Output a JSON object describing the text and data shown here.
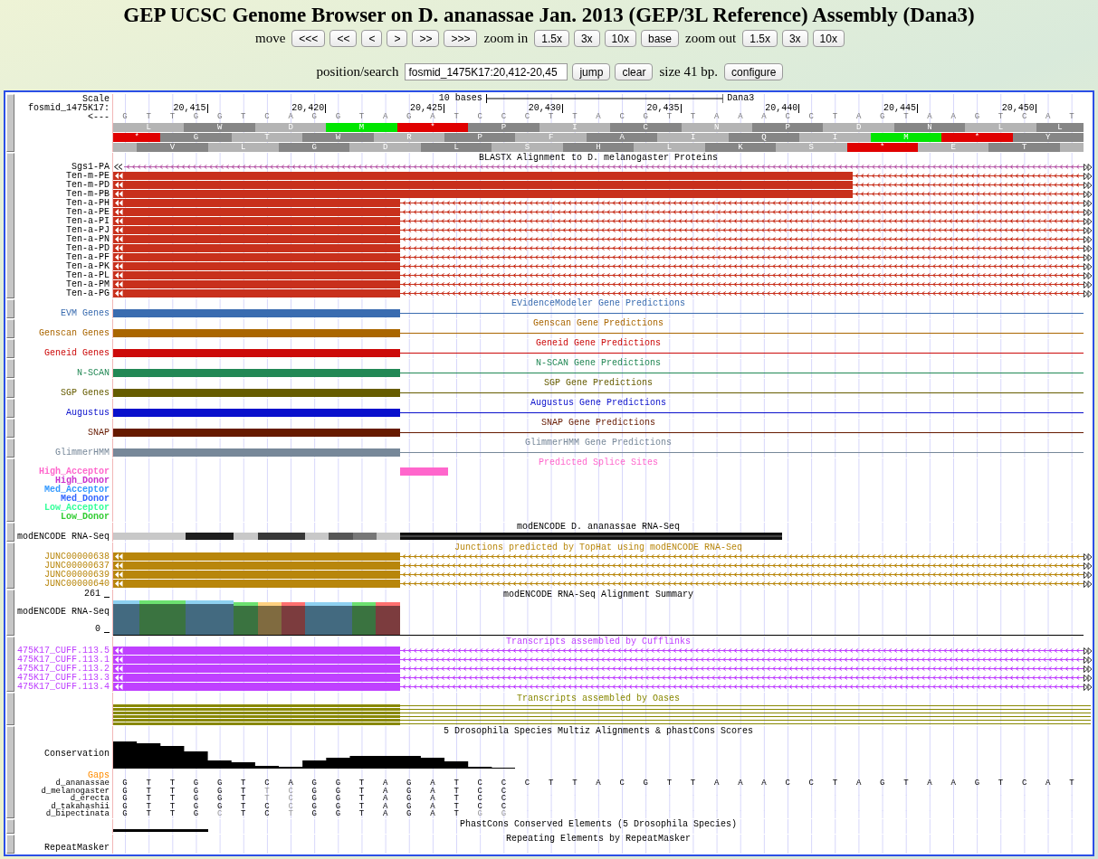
{
  "header": {
    "title": "GEP UCSC Genome Browser on D. ananassae Jan. 2013 (GEP/3L Reference) Assembly (Dana3)",
    "move_label": "move",
    "move_buttons": [
      "<<<",
      "<<",
      "<",
      ">",
      ">>",
      ">>>"
    ],
    "zoom_in_label": "zoom in",
    "zoom_in_buttons": [
      "1.5x",
      "3x",
      "10x",
      "base"
    ],
    "zoom_out_label": "zoom out",
    "zoom_out_buttons": [
      "1.5x",
      "3x",
      "10x"
    ],
    "position_label": "position/search",
    "position_value": "fosmid_1475K17:20,412-20,45",
    "position_buttons": [
      "jump",
      "clear"
    ],
    "size_text": "size 41 bp.",
    "configure_button": "configure"
  },
  "ruler": {
    "scale_label": "Scale",
    "scale_text": "10 bases",
    "assembly": "Dana3",
    "chrom_label": "fosmid_1475K17:",
    "strand_label": "<---",
    "ticks": [
      "20,415",
      "20,420",
      "20,425",
      "20,430",
      "20,435",
      "20,440",
      "20,445",
      "20,450"
    ],
    "bases": [
      "G",
      "T",
      "T",
      "G",
      "G",
      "T",
      "C",
      "A",
      "G",
      "G",
      "T",
      "A",
      "G",
      "A",
      "T",
      "C",
      "C",
      "C",
      "T",
      "T",
      "A",
      "C",
      "G",
      "T",
      "T",
      "A",
      "A",
      "A",
      "C",
      "C",
      "T",
      "A",
      "G",
      "T",
      "A",
      "A",
      "G",
      "T",
      "C",
      "A",
      "T"
    ],
    "frames": [
      [
        {
          "aa": "L",
          "kind": "residue"
        },
        {
          "aa": "W",
          "kind": "residue"
        },
        {
          "aa": "D",
          "kind": "residue"
        },
        {
          "aa": "M",
          "kind": "start"
        },
        {
          "aa": "*",
          "kind": "stop"
        },
        {
          "aa": "P",
          "kind": "residue"
        },
        {
          "aa": "I",
          "kind": "residue"
        },
        {
          "aa": "C",
          "kind": "residue"
        },
        {
          "aa": "N",
          "kind": "residue"
        },
        {
          "aa": "P",
          "kind": "residue"
        },
        {
          "aa": "D",
          "kind": "residue"
        },
        {
          "aa": "N",
          "kind": "residue"
        },
        {
          "aa": "L",
          "kind": "residue"
        },
        {
          "aa": "L",
          "kind": "residue"
        }
      ],
      [
        {
          "aa": "*",
          "kind": "stop"
        },
        {
          "aa": "G",
          "kind": "residue"
        },
        {
          "aa": "T",
          "kind": "residue"
        },
        {
          "aa": "W",
          "kind": "residue"
        },
        {
          "aa": "R",
          "kind": "residue"
        },
        {
          "aa": "P",
          "kind": "residue"
        },
        {
          "aa": "F",
          "kind": "residue"
        },
        {
          "aa": "A",
          "kind": "residue"
        },
        {
          "aa": "I",
          "kind": "residue"
        },
        {
          "aa": "Q",
          "kind": "residue"
        },
        {
          "aa": "I",
          "kind": "residue"
        },
        {
          "aa": "M",
          "kind": "start"
        },
        {
          "aa": "*",
          "kind": "stop"
        },
        {
          "aa": "Y",
          "kind": "residue"
        }
      ],
      [
        {
          "aa": "V",
          "kind": "residue"
        },
        {
          "aa": "L",
          "kind": "residue"
        },
        {
          "aa": "G",
          "kind": "residue"
        },
        {
          "aa": "D",
          "kind": "residue"
        },
        {
          "aa": "L",
          "kind": "residue"
        },
        {
          "aa": "S",
          "kind": "residue"
        },
        {
          "aa": "H",
          "kind": "residue"
        },
        {
          "aa": "L",
          "kind": "residue"
        },
        {
          "aa": "K",
          "kind": "residue"
        },
        {
          "aa": "S",
          "kind": "residue"
        },
        {
          "aa": "*",
          "kind": "stop"
        },
        {
          "aa": "E",
          "kind": "residue"
        },
        {
          "aa": "T",
          "kind": "residue"
        }
      ]
    ]
  },
  "tracks": [
    {
      "kind": "blastx",
      "title": "BLASTX Alignment to D. melanogaster Proteins",
      "items": [
        {
          "label": "Sgs1-PA",
          "kind": "line"
        },
        {
          "label": "Ten-m-PE",
          "kind": "long"
        },
        {
          "label": "Ten-m-PD",
          "kind": "long"
        },
        {
          "label": "Ten-m-PB",
          "kind": "long"
        },
        {
          "label": "Ten-a-PH",
          "kind": "short"
        },
        {
          "label": "Ten-a-PE",
          "kind": "short"
        },
        {
          "label": "Ten-a-PI",
          "kind": "short"
        },
        {
          "label": "Ten-a-PJ",
          "kind": "short"
        },
        {
          "label": "Ten-a-PN",
          "kind": "short"
        },
        {
          "label": "Ten-a-PD",
          "kind": "short"
        },
        {
          "label": "Ten-a-PF",
          "kind": "short"
        },
        {
          "label": "Ten-a-PK",
          "kind": "short"
        },
        {
          "label": "Ten-a-PL",
          "kind": "short"
        },
        {
          "label": "Ten-a-PM",
          "kind": "short"
        },
        {
          "label": "Ten-a-PG",
          "kind": "short"
        }
      ]
    },
    {
      "kind": "gene",
      "label": "EVM Genes",
      "title": "EVidenceModeler Gene Predictions",
      "color": "#3a6cb0"
    },
    {
      "kind": "gene",
      "label": "Genscan Genes",
      "title": "Genscan Gene Predictions",
      "color": "#aa6600"
    },
    {
      "kind": "gene",
      "label": "Geneid Genes",
      "title": "Geneid Gene Predictions",
      "color": "#cc0a0a"
    },
    {
      "kind": "gene",
      "label": "N-SCAN",
      "title": "N-SCAN Gene Predictions",
      "color": "#228855"
    },
    {
      "kind": "gene",
      "label": "SGP Genes",
      "title": "SGP Gene Predictions",
      "color": "#665c00"
    },
    {
      "kind": "gene",
      "label": "Augustus",
      "title": "Augustus Gene Predictions",
      "color": "#0a10cc"
    },
    {
      "kind": "gene",
      "label": "SNAP",
      "title": "SNAP Gene Predictions",
      "color": "#661a00"
    },
    {
      "kind": "gene",
      "label": "GlimmerHMM",
      "title": "GlimmerHMM Gene Predictions",
      "color": "#778899"
    },
    {
      "kind": "splice",
      "title": "Predicted Splice Sites",
      "color": "#ff66cc",
      "items": [
        {
          "label": "High_Acceptor",
          "color": "#ff66cc",
          "hit": true
        },
        {
          "label": "High_Donor",
          "color": "#cc33cc",
          "hit": false
        },
        {
          "label": "Med_Acceptor",
          "color": "#3399ff",
          "hit": false
        },
        {
          "label": "Med_Donor",
          "color": "#3366ff",
          "hit": false
        },
        {
          "label": "Low_Acceptor",
          "color": "#33ff99",
          "hit": false
        },
        {
          "label": "Low_Donor",
          "color": "#33cc33",
          "hit": false
        }
      ]
    },
    {
      "kind": "rnaseq",
      "label": "modENCODE RNA-Seq",
      "title": "modENCODE D. ananassae RNA-Seq"
    },
    {
      "kind": "transcripts",
      "title": "Junctions predicted by TopHat using modENCODE RNA-Seq",
      "color": "#b8860b",
      "items": [
        "JUNC00000638",
        "JUNC00000637",
        "JUNC00000639",
        "JUNC00000640"
      ]
    },
    {
      "kind": "summary",
      "title": "modENCODE RNA-Seq Alignment Summary",
      "label": "modENCODE RNA-Seq",
      "max": "261",
      "min": "0"
    },
    {
      "kind": "transcripts",
      "title": "Transcripts assembled by Cufflinks",
      "color": "#bf40ff",
      "items": [
        "475K17_CUFF.113.5",
        "475K17_CUFF.113.1",
        "475K17_CUFF.113.2",
        "475K17_CUFF.113.3",
        "475K17_CUFF.113.4"
      ]
    },
    {
      "kind": "oases",
      "title": "Transcripts assembled by Oases",
      "color": "#888800"
    },
    {
      "kind": "multiz",
      "title": "5 Drosophila Species Multiz Alignments & phastCons Scores",
      "conservation_label": "Conservation",
      "gaps_label": "Gaps",
      "species": [
        {
          "name": "d_ananassae",
          "bases": [
            "G",
            "T",
            "T",
            "G",
            "G",
            "T",
            "C",
            "A",
            "G",
            "G",
            "T",
            "A",
            "G",
            "A",
            "T",
            "C",
            "C",
            "C",
            "T",
            "T",
            "A",
            "C",
            "G",
            "T",
            "T",
            "A",
            "A",
            "A",
            "C",
            "C",
            "T",
            "A",
            "G",
            "T",
            "A",
            "A",
            "G",
            "T",
            "C",
            "A",
            "T"
          ]
        },
        {
          "name": "d_melanogaster",
          "bases": [
            "G",
            "T",
            "T",
            "G",
            "G",
            "T",
            "T",
            "C",
            "G",
            "G",
            "T",
            "A",
            "G",
            "A",
            "T",
            "C",
            "C"
          ]
        },
        {
          "name": "d_erecta",
          "bases": [
            "G",
            "T",
            "T",
            "G",
            "G",
            "T",
            "T",
            "C",
            "G",
            "G",
            "T",
            "A",
            "G",
            "A",
            "T",
            "C",
            "C"
          ]
        },
        {
          "name": "d_takahashii",
          "bases": [
            "G",
            "T",
            "T",
            "G",
            "G",
            "T",
            "C",
            "C",
            "G",
            "G",
            "T",
            "A",
            "G",
            "A",
            "T",
            "C",
            "C"
          ]
        },
        {
          "name": "d_bipectinata",
          "bases": [
            "G",
            "T",
            "T",
            "G",
            "C",
            "T",
            "C",
            "T",
            "G",
            "G",
            "T",
            "A",
            "G",
            "A",
            "T",
            "G",
            "G"
          ]
        }
      ]
    },
    {
      "kind": "phastcons",
      "title": "PhastCons Conserved Elements (5 Drosophila Species)"
    },
    {
      "kind": "repeats",
      "title": "Repeating Elements by RepeatMasker",
      "label": "RepeatMasker"
    }
  ]
}
